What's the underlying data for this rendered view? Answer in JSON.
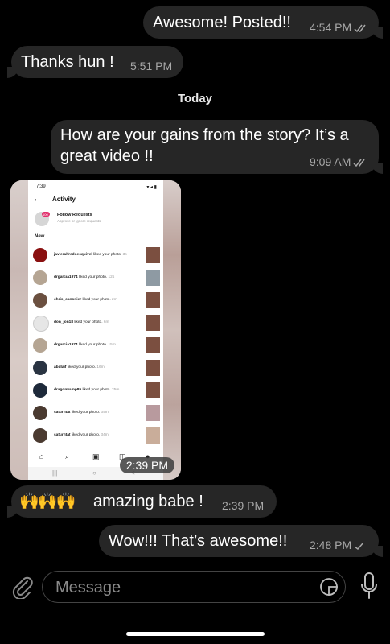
{
  "messages": {
    "m1": {
      "text": "Awesome! Posted!!",
      "time": "4:54 PM"
    },
    "m2": {
      "text": "Thanks hun !",
      "time": "5:51 PM"
    },
    "date_separator": "Today",
    "m3": {
      "text": "How are your gains from the story? It’s a great video !!",
      "time": "9:09 AM"
    },
    "m4": {
      "time": "2:39 PM"
    },
    "m5": {
      "emoji": "🙌🙌🙌",
      "text": "amazing babe !",
      "time": "2:39 PM"
    },
    "m6": {
      "text": "Wow!!! That’s awesome!!",
      "time": "2:48 PM"
    }
  },
  "screenshot": {
    "status_time": "7:39",
    "status_right": "▾ ◂ ▮",
    "title": "Activity",
    "follow_requests": "Follow Requests",
    "follow_sub": "Approve or ignore requests",
    "badge": "100",
    "section": "New",
    "rows": [
      {
        "user": "javieralfredoesquivel",
        "action": "liked your photo.",
        "ago": "3s"
      },
      {
        "user": "drgarcia1974",
        "action": "liked your photo.",
        "ago": "12s"
      },
      {
        "user": "chris_canonier",
        "action": "liked your photo.",
        "ago": "2m"
      },
      {
        "user": "don_jon18",
        "action": "liked your photo.",
        "ago": "6m"
      },
      {
        "user": "drgarcia1974",
        "action": "liked your photo.",
        "ago": "15m"
      },
      {
        "user": "abdlaif",
        "action": "liked your photo.",
        "ago": "16m"
      },
      {
        "user": "dragonvamp85",
        "action": "liked your photo.",
        "ago": "25m"
      },
      {
        "user": "saturntat",
        "action": "liked your photo.",
        "ago": "34m"
      },
      {
        "user": "saturntat",
        "action": "liked your photo.",
        "ago": "34m"
      }
    ],
    "nav_icons": [
      "home-icon",
      "search-icon",
      "reels-icon",
      "shop-icon",
      "profile-icon"
    ],
    "android_nav": [
      "|||",
      "○",
      "<"
    ]
  },
  "composer": {
    "placeholder": "Message"
  },
  "icons": [
    "attach-icon",
    "sticker-icon",
    "mic-icon",
    "double-check-icon",
    "single-check-icon",
    "back-arrow-icon"
  ],
  "colors": {
    "background": "#000000",
    "bubble": "#262626",
    "meta": "#a8a8a8"
  }
}
